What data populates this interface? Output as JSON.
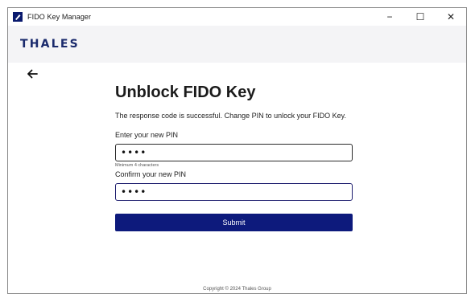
{
  "window": {
    "title": "FIDO Key Manager",
    "icon": "fido-key-icon",
    "controls": {
      "minimize": "−",
      "maximize": "☐",
      "close": "✕"
    }
  },
  "brand": {
    "logo_text": "THALES",
    "color": "#1a2a6c"
  },
  "nav": {
    "back_icon": "arrow-left-icon"
  },
  "form": {
    "title": "Unblock FIDO Key",
    "subtitle": "The response code is successful. Change PIN to unlock your FIDO Key.",
    "new_pin": {
      "label": "Enter your new PIN",
      "value": "••••",
      "hint": "Minimum 4 characters"
    },
    "confirm_pin": {
      "label": "Confirm your new PIN",
      "value": "••••"
    },
    "submit_label": "Submit",
    "submit_color": "#0d1a7c"
  },
  "footer": {
    "copyright": "Copyright © 2024 Thales Group"
  }
}
